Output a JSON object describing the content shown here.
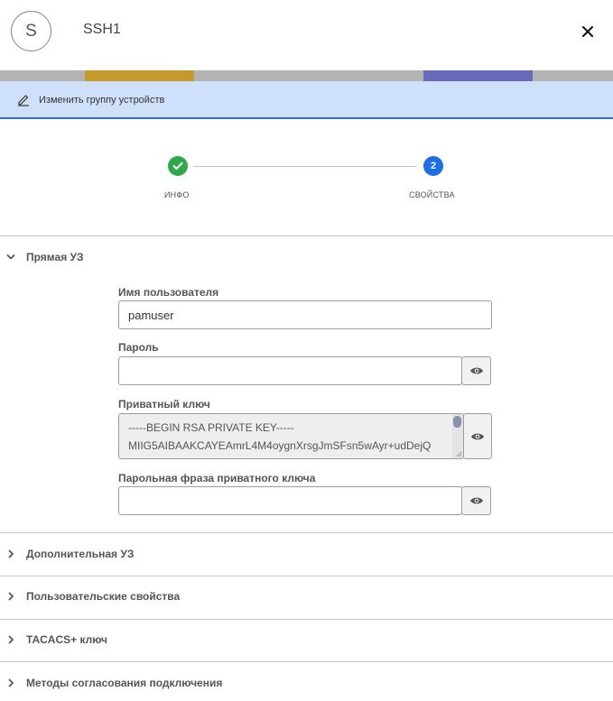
{
  "header": {
    "avatar_letter": "S",
    "title": "SSH1"
  },
  "edit_bar": {
    "label": "Изменить группу устройств"
  },
  "stepper": {
    "steps": [
      {
        "label": "ИНФО",
        "state": "done"
      },
      {
        "label": "СВОЙСТВА",
        "number": "2",
        "state": "active"
      }
    ]
  },
  "sections": {
    "primary": {
      "title": "Прямая УЗ",
      "expanded": true,
      "fields": {
        "username": {
          "label": "Имя пользователя",
          "value": "pamuser"
        },
        "password": {
          "label": "Пароль",
          "value": ""
        },
        "private_key": {
          "label": "Приватный ключ",
          "line1": "-----BEGIN RSA PRIVATE KEY-----",
          "line2": "MIIG5AIBAAKCAYEAmrL4M4oygnXrsgJmSFsn5wAyr+udDejQ"
        },
        "passphrase": {
          "label": "Парольная фраза приватного ключа",
          "value": ""
        }
      }
    },
    "collapsed": [
      {
        "title": "Дополнительная УЗ"
      },
      {
        "title": "Пользовательские свойства"
      },
      {
        "title": "TACACS+ ключ"
      },
      {
        "title": "Методы согласования подключения"
      }
    ]
  },
  "colors": {
    "step_done": "#2fa84a",
    "step_active": "#1f6ee8",
    "edit_bar_bg": "#cfe0fb",
    "edit_bar_border": "#2a6ed9"
  }
}
